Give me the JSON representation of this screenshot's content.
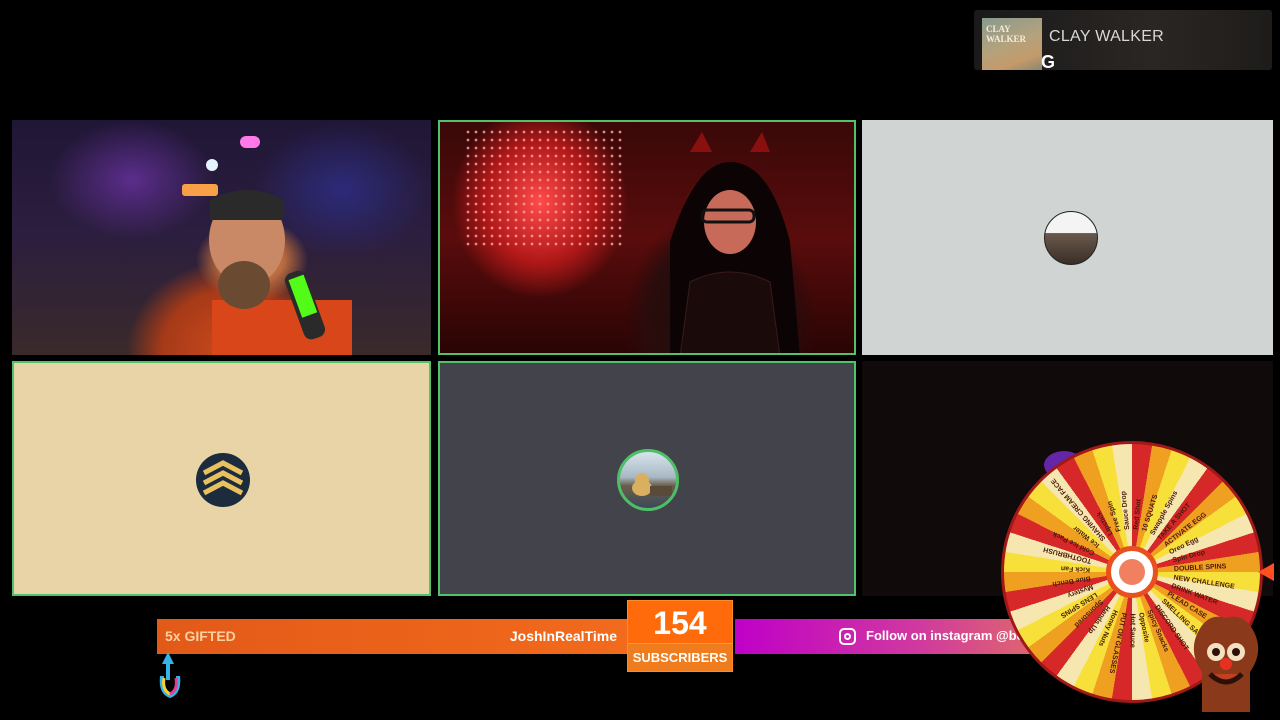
{
  "now_playing": {
    "artist": "CLAY WALKER",
    "track": "G",
    "album_art_text": "CLAY WALKER"
  },
  "tiles": [
    {
      "id": 1,
      "type": "camera",
      "active": false
    },
    {
      "id": 2,
      "type": "camera",
      "active": true
    },
    {
      "id": 3,
      "type": "avatar",
      "background": "#d0d4d2"
    },
    {
      "id": 4,
      "type": "avatar",
      "background": "#e8d4a6",
      "active": true
    },
    {
      "id": 5,
      "type": "avatar",
      "background": "#43434b",
      "active": true,
      "speaking": true
    },
    {
      "id": 6,
      "type": "empty",
      "background": "#100a0a"
    }
  ],
  "ticker": {
    "gift_text": "5x GIFTED",
    "gifter": "JoshInRealTime",
    "subscriber_count": "154",
    "subscriber_label": "SUBSCRIBERS",
    "follow_text": "Follow on instagram @bobo_kick",
    "icon": "instagram-icon"
  },
  "wheel": {
    "segments": [
      "Red Shot",
      "10 SQUATS",
      "Swapple Spins",
      "TAKE A SHOT",
      "ACTIVATE EGG",
      "Oreo Egg",
      "Spin Drop",
      "DOUBLE SPINS",
      "NEW CHALLENGE",
      "DRINK WATER",
      "PLEAD CASE",
      "SMELLING SALT",
      "DISCORD SHOT",
      "Spicy Snacks",
      "Opposite",
      "Hot Sauce",
      "PUT ON GLASSES",
      "Honey Nuts",
      "Hands Up",
      "Sponsored",
      "LENS SPINS",
      "Mystery",
      "Blue Bench",
      "Kick Fan",
      "TOOTHBRUSH",
      "Cold Ice Pack",
      "Ice Water",
      "SHAVING CREAM FACE",
      "Lipstick",
      "Free Spin",
      "Sauce Drop"
    ],
    "colors": {
      "red": "#d62828",
      "orange": "#f0a020",
      "yellow": "#f8e03a",
      "cream": "#f6e6b0"
    }
  },
  "colors": {
    "active_border": "#51c26a",
    "ticker_orange": "#f26a1c",
    "ticker_magenta": "#c000c8",
    "accent_orange": "#ff6a0a"
  }
}
